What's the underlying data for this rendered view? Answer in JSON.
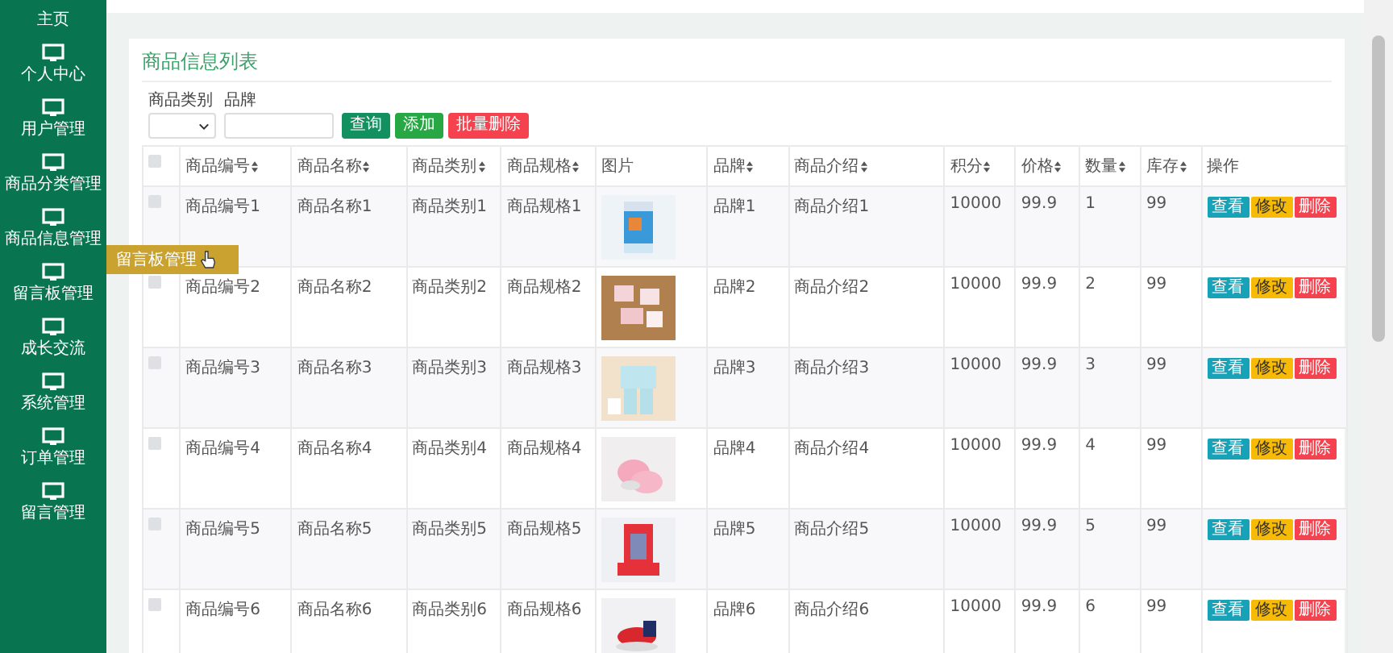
{
  "sidebar": {
    "items": [
      {
        "label": "主页",
        "icon": false
      },
      {
        "label": "个人中心",
        "icon": true
      },
      {
        "label": "用户管理",
        "icon": true
      },
      {
        "label": "商品分类管理",
        "icon": true
      },
      {
        "label": "商品信息管理",
        "icon": true
      },
      {
        "label": "留言板管理",
        "icon": true,
        "submenu": [
          {
            "label": "留言板管理"
          }
        ]
      },
      {
        "label": "成长交流",
        "icon": true
      },
      {
        "label": "系统管理",
        "icon": true
      },
      {
        "label": "订单管理",
        "icon": true
      },
      {
        "label": "留言管理",
        "icon": true
      }
    ]
  },
  "panel": {
    "title": "商品信息列表",
    "filters": [
      {
        "label": "商品类别",
        "kind": "select"
      },
      {
        "label": "品牌",
        "kind": "input"
      }
    ],
    "buttons": [
      {
        "label": "查询",
        "kind": "search"
      },
      {
        "label": "添加",
        "kind": "add"
      },
      {
        "label": "批量删除",
        "kind": "delete"
      }
    ]
  },
  "table": {
    "header_checked": false,
    "columns": [
      {
        "label": "商品编号",
        "sortable": true
      },
      {
        "label": "商品名称",
        "sortable": true
      },
      {
        "label": "商品类别",
        "sortable": true
      },
      {
        "label": "商品规格",
        "sortable": true
      },
      {
        "label": "图片",
        "sortable": false
      },
      {
        "label": "品牌",
        "sortable": true
      },
      {
        "label": "商品介绍",
        "sortable": true
      },
      {
        "label": "积分",
        "sortable": true
      },
      {
        "label": "价格",
        "sortable": true
      },
      {
        "label": "数量",
        "sortable": true
      },
      {
        "label": "库存",
        "sortable": true
      },
      {
        "label": "操作",
        "sortable": false
      }
    ],
    "rows": [
      {
        "checked": false,
        "cells": [
          "商品编号1",
          "商品名称1",
          "商品类别1",
          "商品规格1",
          {
            "kind": "picture"
          },
          "品牌1",
          "商品介绍1",
          "10000",
          "99.9",
          "1",
          "99",
          {
            "actions": [
              {
                "label": "查看",
                "kind": "view"
              },
              {
                "label": "修改",
                "kind": "edit"
              },
              {
                "label": "删除",
                "kind": "delete"
              }
            ]
          }
        ]
      },
      {
        "checked": false,
        "cells": [
          "商品编号2",
          "商品名称2",
          "商品类别2",
          "商品规格2",
          {
            "kind": "picture"
          },
          "品牌2",
          "商品介绍2",
          "10000",
          "99.9",
          "2",
          "99",
          {
            "actions": [
              {
                "label": "查看",
                "kind": "view"
              },
              {
                "label": "修改",
                "kind": "edit"
              },
              {
                "label": "删除",
                "kind": "delete"
              }
            ]
          }
        ]
      },
      {
        "checked": false,
        "cells": [
          "商品编号3",
          "商品名称3",
          "商品类别3",
          "商品规格3",
          {
            "kind": "picture"
          },
          "品牌3",
          "商品介绍3",
          "10000",
          "99.9",
          "3",
          "99",
          {
            "actions": [
              {
                "label": "查看",
                "kind": "view"
              },
              {
                "label": "修改",
                "kind": "edit"
              },
              {
                "label": "删除",
                "kind": "delete"
              }
            ]
          }
        ]
      },
      {
        "checked": false,
        "cells": [
          "商品编号4",
          "商品名称4",
          "商品类别4",
          "商品规格4",
          {
            "kind": "picture"
          },
          "品牌4",
          "商品介绍4",
          "10000",
          "99.9",
          "4",
          "99",
          {
            "actions": [
              {
                "label": "查看",
                "kind": "view"
              },
              {
                "label": "修改",
                "kind": "edit"
              },
              {
                "label": "删除",
                "kind": "delete"
              }
            ]
          }
        ]
      },
      {
        "checked": false,
        "cells": [
          "商品编号5",
          "商品名称5",
          "商品类别5",
          "商品规格5",
          {
            "kind": "picture"
          },
          "品牌5",
          "商品介绍5",
          "10000",
          "99.9",
          "5",
          "99",
          {
            "actions": [
              {
                "label": "查看",
                "kind": "view"
              },
              {
                "label": "修改",
                "kind": "edit"
              },
              {
                "label": "删除",
                "kind": "delete"
              }
            ]
          }
        ]
      },
      {
        "checked": false,
        "cells": [
          "商品编号6",
          "商品名称6",
          "商品类别6",
          "商品规格6",
          {
            "kind": "picture"
          },
          "品牌6",
          "商品介绍6",
          "10000",
          "99.9",
          "6",
          "99",
          {
            "actions": [
              {
                "label": "查看",
                "kind": "view"
              },
              {
                "label": "修改",
                "kind": "edit"
              },
              {
                "label": "删除",
                "kind": "delete"
              }
            ]
          }
        ]
      }
    ]
  }
}
